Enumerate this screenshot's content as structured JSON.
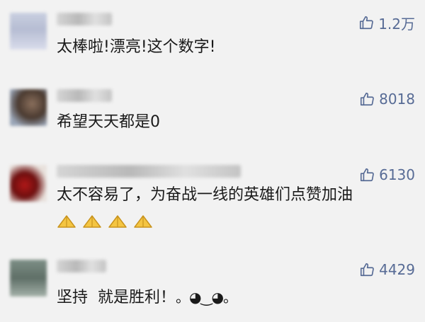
{
  "comments": [
    {
      "likes": "1.2万",
      "text": "太棒啦!漂亮!这个数字!"
    },
    {
      "likes": "8018",
      "text": "希望天天都是0"
    },
    {
      "likes": "6130",
      "text": "太不容易了，为奋战一线的英雄们点赞加油",
      "emoji_count": 4
    },
    {
      "likes": "4429",
      "text": "坚持  就是胜利！",
      "tail": "。◕‿◕。"
    }
  ],
  "icons": {
    "like": "thumbs-up-icon",
    "emoji": "folded-hands-icon"
  },
  "colors": {
    "like": "#576b95",
    "background": "#f2f2f2",
    "text": "#1a1a1a"
  }
}
